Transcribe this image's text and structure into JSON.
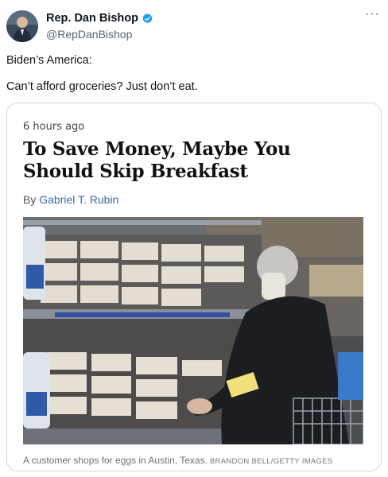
{
  "author": {
    "display_name": "Rep. Dan Bishop",
    "handle": "@RepDanBishop",
    "verified_icon": "verified-badge-icon",
    "avatar_icon": "avatar-photo"
  },
  "menu": {
    "more_label": "···"
  },
  "tweet": {
    "line1": "Biden’s America:",
    "line2": "Can’t afford groceries? Just don’t eat."
  },
  "card": {
    "timestamp": "6 hours ago",
    "headline": "To Save Money, Maybe You Should Skip Breakfast",
    "byline_prefix": "By ",
    "byline_author": "Gabriel T. Rubin",
    "image_description_icon": "grocery-eggs-photo",
    "caption": "A customer shops for eggs in Austin, Texas.",
    "credit": "BRANDON BELL/GETTY IMAGES"
  },
  "colors": {
    "verified_blue": "#1d9bf0",
    "link_blue": "#3a6da0",
    "muted": "#536471"
  }
}
